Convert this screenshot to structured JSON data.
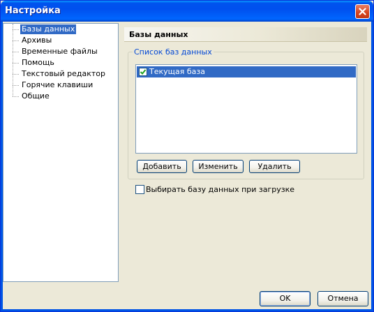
{
  "window": {
    "title": "Настройка"
  },
  "tree": {
    "items": [
      {
        "label": "Базы данных",
        "selected": true
      },
      {
        "label": "Архивы",
        "selected": false
      },
      {
        "label": "Временные файлы",
        "selected": false
      },
      {
        "label": "Помощь",
        "selected": false
      },
      {
        "label": "Текстовый редактор",
        "selected": false
      },
      {
        "label": "Горячие клавиши",
        "selected": false
      },
      {
        "label": "Общие",
        "selected": false
      }
    ]
  },
  "panel": {
    "title": "Базы данных",
    "group_label": "Список баз данных",
    "databases": [
      {
        "name": "Текущая база",
        "checked": true,
        "selected": true
      }
    ],
    "add_label": "Добавить",
    "edit_label": "Изменить",
    "delete_label": "Удалить",
    "select_on_load_label": "Выбирать базу данных при загрузке",
    "select_on_load_checked": false
  },
  "footer": {
    "ok_label": "OK",
    "cancel_label": "Отмена"
  },
  "colors": {
    "accent": "#0055e5",
    "selection": "#316ac5",
    "group_label": "#0046d5"
  }
}
